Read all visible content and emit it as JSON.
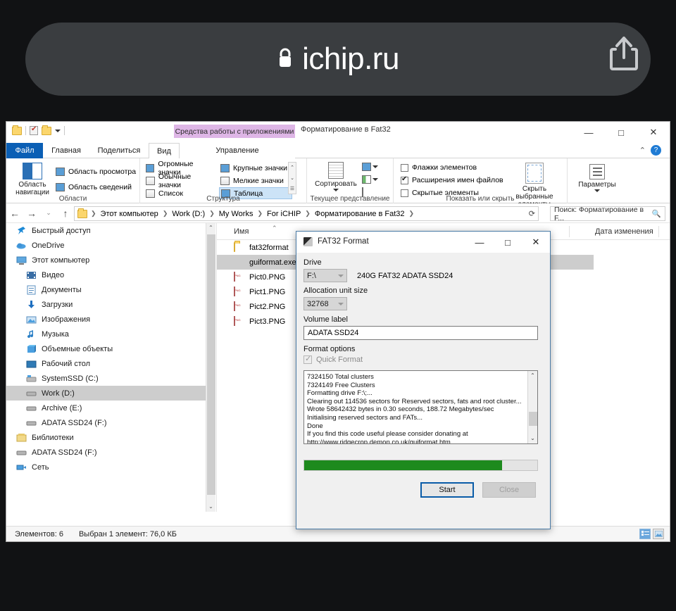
{
  "browser": {
    "lock_icon": "lock-icon",
    "url": "ichip.ru",
    "share_icon": "share-icon"
  },
  "explorer": {
    "window_title": "Форматирование в Fat32",
    "contextual_tab_header": "Средства работы с приложениями",
    "contextual_tab_color": "#deb6e6",
    "accent_color": "#0b5fb5",
    "quick_access": {
      "folder_icon": "folder-icon",
      "properties_icon": "properties-icon",
      "new_folder_icon": "new-folder-icon",
      "dropdown_icon": "chevron-down-icon"
    },
    "window_buttons": {
      "minimize": "—",
      "maximize": "□",
      "close": "✕"
    },
    "tabs": [
      {
        "label": "Файл",
        "name": "tab-file"
      },
      {
        "label": "Главная",
        "name": "tab-home"
      },
      {
        "label": "Поделиться",
        "name": "tab-share"
      },
      {
        "label": "Вид",
        "name": "tab-view"
      },
      {
        "label": "Управление",
        "name": "tab-manage"
      }
    ],
    "ribbon_collapse_icon": "chevron-up-icon",
    "help_icon": "?",
    "ribbon": {
      "group_panes": {
        "label": "Области",
        "nav_pane": "Область\nнавигации",
        "preview_pane": "Область просмотра",
        "details_pane": "Область сведений"
      },
      "group_layout": {
        "label": "Структура",
        "items": [
          "Огромные значки",
          "Крупные значки",
          "Обычные значки",
          "Мелкие значки",
          "Список",
          "Таблица"
        ],
        "selected": "Таблица"
      },
      "group_current_view": {
        "label": "Текущее представление",
        "sort_by": "Сортировать"
      },
      "group_show_hide": {
        "label": "Показать или скрыть",
        "checkboxes": [
          {
            "label": "Флажки элементов",
            "checked": false
          },
          {
            "label": "Расширения имен файлов",
            "checked": true
          },
          {
            "label": "Скрытые элементы",
            "checked": false
          }
        ],
        "hide_selected": "Скрыть выбранные\nэлементы"
      },
      "group_options": {
        "label": "",
        "options": "Параметры"
      }
    },
    "address_bar": {
      "back_icon": "arrow-left-icon",
      "forward_icon": "arrow-right-icon",
      "recent_icon": "chevron-down-icon",
      "up_icon": "arrow-up-icon",
      "refresh_icon": "refresh-icon",
      "breadcrumbs": [
        "Этот компьютер",
        "Work (D:)",
        "My Works",
        "For iCHIP",
        "Форматирование в Fat32"
      ]
    },
    "search": {
      "text": "Поиск: Форматирование в F...",
      "icon": "search-icon"
    },
    "nav_pane": [
      {
        "label": "Быстрый доступ",
        "icon": "pin-icon",
        "indent": false,
        "selected": false
      },
      {
        "label": "OneDrive",
        "icon": "cloud-icon",
        "indent": false,
        "selected": false
      },
      {
        "label": "Этот компьютер",
        "icon": "computer-icon",
        "indent": false,
        "selected": false
      },
      {
        "label": "Видео",
        "icon": "video-icon",
        "indent": true,
        "selected": false
      },
      {
        "label": "Документы",
        "icon": "documents-icon",
        "indent": true,
        "selected": false
      },
      {
        "label": "Загрузки",
        "icon": "downloads-icon",
        "indent": true,
        "selected": false
      },
      {
        "label": "Изображения",
        "icon": "pictures-icon",
        "indent": true,
        "selected": false
      },
      {
        "label": "Музыка",
        "icon": "music-icon",
        "indent": true,
        "selected": false
      },
      {
        "label": "Объемные объекты",
        "icon": "3d-objects-icon",
        "indent": true,
        "selected": false
      },
      {
        "label": "Рабочий стол",
        "icon": "desktop-icon",
        "indent": true,
        "selected": false
      },
      {
        "label": "SystemSSD (C:)",
        "icon": "system-drive-icon",
        "indent": true,
        "selected": false
      },
      {
        "label": "Work (D:)",
        "icon": "drive-icon",
        "indent": true,
        "selected": true
      },
      {
        "label": "Archive (E:)",
        "icon": "drive-icon",
        "indent": true,
        "selected": false
      },
      {
        "label": "ADATA SSD24 (F:)",
        "icon": "drive-icon",
        "indent": true,
        "selected": false
      },
      {
        "label": "Библиотеки",
        "icon": "libraries-icon",
        "indent": false,
        "selected": false
      },
      {
        "label": "ADATA SSD24 (F:)",
        "icon": "drive-icon",
        "indent": false,
        "selected": false
      },
      {
        "label": "Сеть",
        "icon": "network-icon",
        "indent": false,
        "selected": false
      }
    ],
    "file_list": {
      "columns": {
        "name": "Имя",
        "date": "Дата изменения",
        "sort_arrow": "chevron-up-icon"
      },
      "rows": [
        {
          "name": "fat32format",
          "icon": "folder-icon",
          "selected": false
        },
        {
          "name": "guiformat.exe",
          "icon": "exe-icon",
          "selected": true
        },
        {
          "name": "Pict0.PNG",
          "icon": "png-icon",
          "selected": false
        },
        {
          "name": "Pict1.PNG",
          "icon": "png-icon",
          "selected": false
        },
        {
          "name": "Pict2.PNG",
          "icon": "png-icon",
          "selected": false
        },
        {
          "name": "Pict3.PNG",
          "icon": "png-icon",
          "selected": false
        }
      ]
    },
    "status_bar": {
      "count": "Элементов: 6",
      "selection": "Выбран 1 элемент: 76,0 КБ",
      "view_details_icon": "details-view-icon",
      "view_large_icon": "large-icons-view-icon"
    }
  },
  "dialog": {
    "title": "FAT32 Format",
    "app_icon": "fat32format-icon",
    "buttons": {
      "minimize": "—",
      "maximize": "□",
      "close": "✕"
    },
    "drive_label": "Drive",
    "drive_value": "F:\\",
    "drive_description": "240G FAT32 ADATA SSD24",
    "allocation_label": "Allocation unit size",
    "allocation_value": "32768",
    "volume_label_label": "Volume label",
    "volume_label_value": "ADATA SSD24",
    "format_options_label": "Format options",
    "quick_format_label": "Quick Format",
    "quick_format_checked": true,
    "quick_format_disabled": true,
    "log_lines": [
      "7324150 Total clusters",
      "7324149 Free Clusters",
      "Formatting drive F:\\;...",
      "Clearing out 114536 sectors for Reserved sectors, fats and root cluster...",
      "Wrote 58642432 bytes in 0.30 seconds, 188.72 Megabytes/sec",
      "Initialising reserved sectors and FATs...",
      "Done",
      "If you find this code useful please consider donating at",
      "http://www.ridgecrop.demon.co.uk/guiformat.htm"
    ],
    "scroll_up_icon": "chevron-up-icon",
    "scroll_down_icon": "chevron-down-icon",
    "progress_percent": 85,
    "progress_color": "#1d8a1d",
    "start_button": "Start",
    "close_button": "Close",
    "close_button_disabled": true
  }
}
